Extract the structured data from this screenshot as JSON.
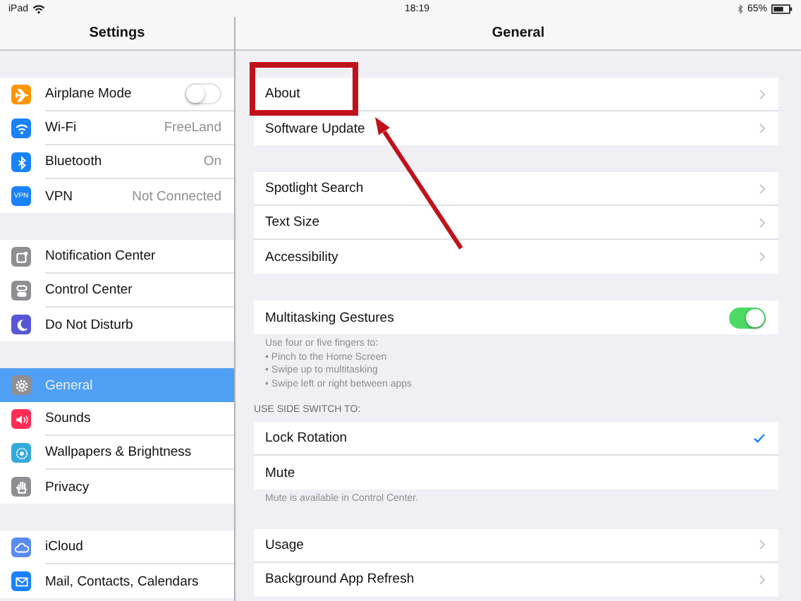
{
  "status_bar": {
    "device": "iPad",
    "time": "18:19",
    "battery": "65%"
  },
  "sidebar": {
    "title": "Settings",
    "groups": [
      {
        "items": [
          {
            "label": "Airplane Mode",
            "kind": "toggle",
            "on": false,
            "color": "#ff9500",
            "selected": false
          },
          {
            "label": "Wi-Fi",
            "kind": "value",
            "value": "FreeLand",
            "color": "#1a82fb",
            "selected": false
          },
          {
            "label": "Bluetooth",
            "kind": "value",
            "value": "On",
            "color": "#1a82fb",
            "selected": false
          },
          {
            "label": "VPN",
            "kind": "value",
            "value": "Not Connected",
            "color": "#1a82fb",
            "icon_text": "VPN",
            "selected": false
          }
        ]
      },
      {
        "items": [
          {
            "label": "Notification Center",
            "kind": "plain",
            "color": "#8e8e93",
            "selected": false
          },
          {
            "label": "Control Center",
            "kind": "plain",
            "color": "#8e8e93",
            "selected": false
          },
          {
            "label": "Do Not Disturb",
            "kind": "plain",
            "color": "#5856d6",
            "selected": false
          }
        ]
      },
      {
        "items": [
          {
            "label": "General",
            "kind": "plain",
            "color": "#8e8e93",
            "selected": true
          },
          {
            "label": "Sounds",
            "kind": "plain",
            "color": "#ff2d55",
            "selected": false
          },
          {
            "label": "Wallpapers & Brightness",
            "kind": "plain",
            "color": "#34aadc",
            "selected": false
          },
          {
            "label": "Privacy",
            "kind": "plain",
            "color": "#8e8e93",
            "selected": false
          }
        ]
      },
      {
        "items": [
          {
            "label": "iCloud",
            "kind": "plain",
            "color": "#5a8cf0",
            "selected": false
          },
          {
            "label": "Mail, Contacts, Calendars",
            "kind": "plain",
            "color": "#1a82fb",
            "selected": false
          }
        ]
      }
    ]
  },
  "detail": {
    "title": "General",
    "sections": [
      {
        "rows": [
          {
            "label": "About",
            "kind": "link"
          },
          {
            "label": "Software Update",
            "kind": "link"
          }
        ]
      },
      {
        "rows": [
          {
            "label": "Spotlight Search",
            "kind": "link"
          },
          {
            "label": "Text Size",
            "kind": "link"
          },
          {
            "label": "Accessibility",
            "kind": "link"
          }
        ]
      },
      {
        "rows": [
          {
            "label": "Multitasking Gestures",
            "kind": "toggle",
            "on": true
          }
        ],
        "footer": [
          "Use four or five fingers to:",
          "• Pinch to the Home Screen",
          "• Swipe up to multitasking",
          "• Swipe left or right between apps"
        ]
      },
      {
        "header": "USE SIDE SWITCH TO:",
        "rows": [
          {
            "label": "Lock Rotation",
            "kind": "option",
            "selected": true
          },
          {
            "label": "Mute",
            "kind": "option",
            "selected": false
          }
        ],
        "footer": [
          "Mute is available in Control Center."
        ]
      },
      {
        "rows": [
          {
            "label": "Usage",
            "kind": "link"
          },
          {
            "label": "Background App Refresh",
            "kind": "link"
          }
        ]
      }
    ]
  }
}
